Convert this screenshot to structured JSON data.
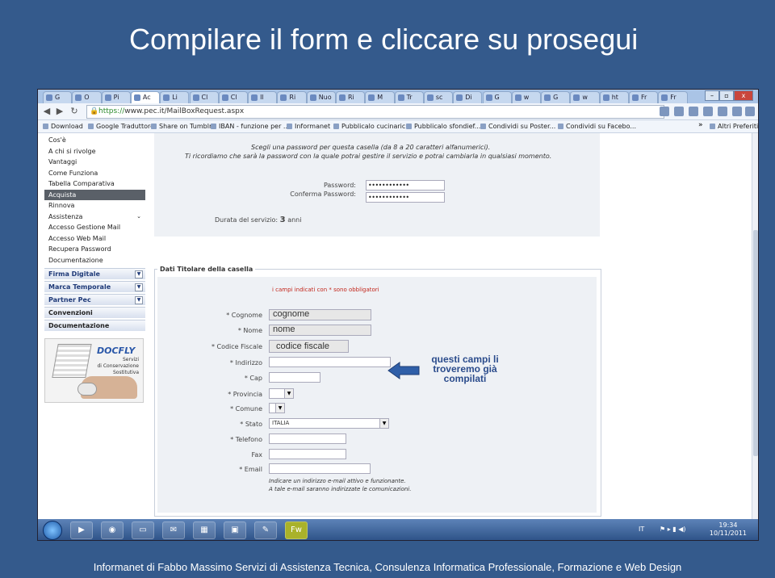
{
  "slide": {
    "title": "Compilare il form e cliccare su prosegui",
    "footer": "Informanet di Fabbo Massimo Servizi di Assistenza Tecnica, Consulenza Informatica Professionale, Formazione e Web Design"
  },
  "browser": {
    "tabs": [
      "G",
      "O",
      "Pi",
      "Ac",
      "Li",
      "Cl",
      "Cl",
      "Il",
      "Ri",
      "Nuo",
      "Ri",
      "M",
      "Tr",
      "sc",
      "Di",
      "G",
      "w",
      "G",
      "w",
      "ht",
      "Fr",
      "Fr"
    ],
    "active_tab": 3,
    "window_controls": [
      "–",
      "▫",
      "x"
    ],
    "url_secure": "https://",
    "url_rest": "www.pec.it/MailBoxRequest.aspx",
    "bookmarks": [
      "Download",
      "Google Traduttore",
      "Share on Tumblr",
      "IBAN - funzione per ...",
      "Informanet",
      "Pubblicalo cucinaric...",
      "Pubblicalo sfondief...",
      "Condividi su Poster...",
      "Condividi su Facebo..."
    ],
    "bookmarks_more": "»",
    "other_bookmarks": "Altri Preferiti"
  },
  "sidebar": {
    "items": [
      "Cos'è",
      "A chi si rivolge",
      "Vantaggi",
      "Come Funziona",
      "Tabella Comparativa",
      "Acquista",
      "Rinnova",
      "Assistenza",
      "Accesso Gestione Mail",
      "Accesso Web Mail",
      "Recupera Password",
      "Documentazione"
    ],
    "active": "Acquista",
    "sections": [
      "Firma Digitale",
      "Marca Temporale",
      "Partner Pec",
      "Convenzioni",
      "Documentazione"
    ],
    "docfly": {
      "logo": "DOCFLY",
      "line1": "Servizi",
      "line2": "di Conservazione",
      "line3": "Sostitutiva"
    }
  },
  "password_panel": {
    "notice_line1": "Scegli una password per questa casella (da 8 a 20 caratteri alfanumerici).",
    "notice_line2": "Ti ricordiamo che sarà la password con la quale potrai gestire il servizio e potrai cambiarla in qualsiasi momento.",
    "password_label": "Password:",
    "password_value": "••••••••••••",
    "confirm_label": "Conferma Password:",
    "confirm_value": "••••••••••••",
    "duration_label": "Durata del servizio:",
    "duration_value": "3",
    "duration_unit": "anni"
  },
  "holder_form": {
    "legend": "Dati Titolare della casella",
    "required_note": "i campi indicati con * sono obbligatori",
    "fields": {
      "cognome": {
        "label": "* Cognome",
        "value": "cognome"
      },
      "nome": {
        "label": "* Nome",
        "value": "nome"
      },
      "codice_fiscale": {
        "label": "* Codice Fiscale",
        "value": "codice fiscale"
      },
      "indirizzo": {
        "label": "* Indirizzo",
        "value": ""
      },
      "cap": {
        "label": "* Cap",
        "value": ""
      },
      "provincia": {
        "label": "* Provincia",
        "value": ""
      },
      "comune": {
        "label": "* Comune",
        "value": ""
      },
      "stato": {
        "label": "* Stato",
        "value": "ITALIA"
      },
      "telefono": {
        "label": "* Telefono",
        "value": ""
      },
      "fax": {
        "label": "Fax",
        "value": ""
      },
      "email": {
        "label": "* Email",
        "value": ""
      }
    },
    "email_hint1": "Indicare un indirizzo e-mail attivo e funzionante.",
    "email_hint2": "A tale e-mail saranno indirizzate le comunicazioni."
  },
  "annotation": {
    "line1": "questi campi li",
    "line2": "troveremo già",
    "line3": "compilati",
    "color": "#2b4c8c"
  },
  "taskbar": {
    "apps": [
      "media-player-icon",
      "chrome-icon",
      "explorer-icon",
      "mail-icon",
      "calendar-icon",
      "powerpoint-icon",
      "notes-icon",
      "fireworks-icon"
    ],
    "fw_label": "Fw",
    "language": "IT",
    "time": "19:34",
    "date": "10/11/2011"
  }
}
